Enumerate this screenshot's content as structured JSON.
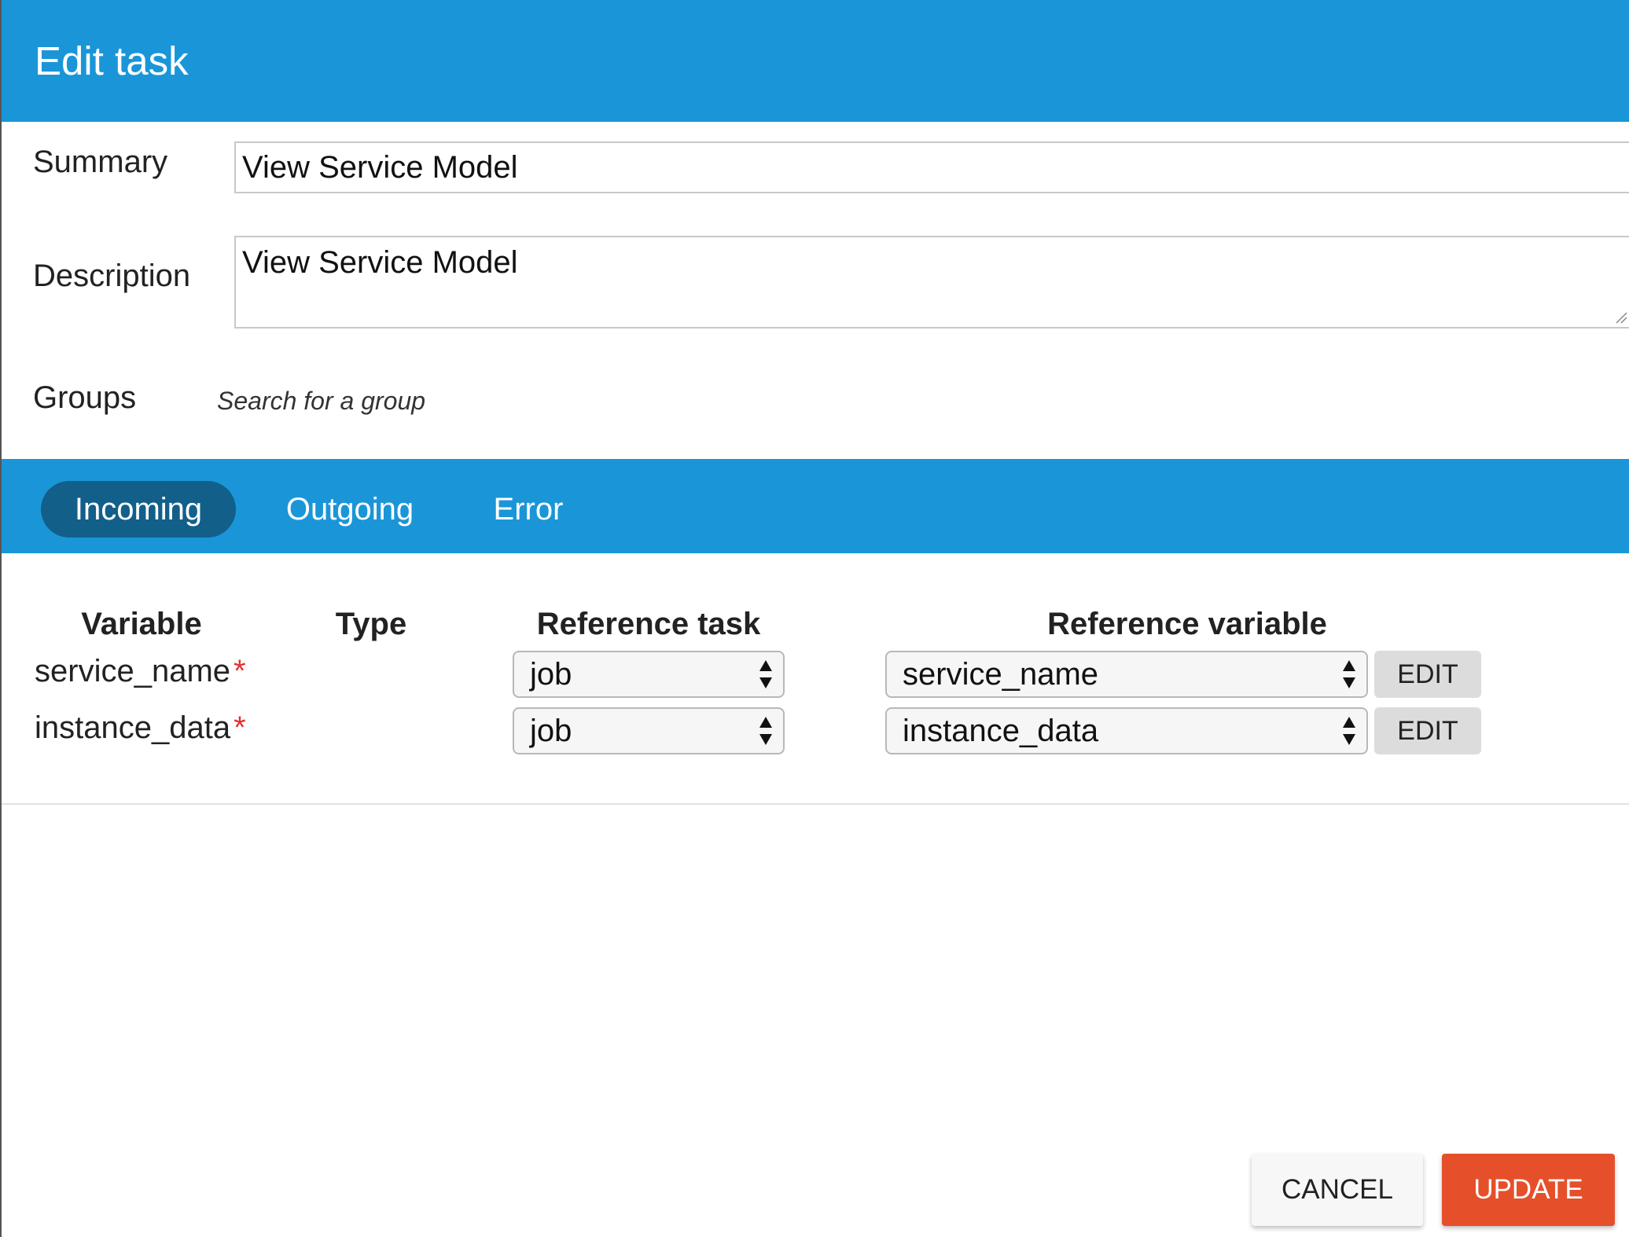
{
  "dialog": {
    "title": "Edit task"
  },
  "form": {
    "summary": {
      "label": "Summary",
      "value": "View Service Model"
    },
    "description": {
      "label": "Description",
      "value": "View Service Model"
    },
    "groups": {
      "label": "Groups",
      "placeholder": "Search for a group"
    }
  },
  "tabs": [
    {
      "label": "Incoming",
      "active": true
    },
    {
      "label": "Outgoing",
      "active": false
    },
    {
      "label": "Error",
      "active": false
    }
  ],
  "table": {
    "headers": {
      "variable": "Variable",
      "type": "Type",
      "reference_task": "Reference task",
      "reference_variable": "Reference variable"
    },
    "required_marker": "*",
    "rows": [
      {
        "variable": "service_name",
        "required": true,
        "type": "",
        "reference_task": "job",
        "reference_variable": "service_name",
        "edit_label": "EDIT"
      },
      {
        "variable": "instance_data",
        "required": true,
        "type": "",
        "reference_task": "job",
        "reference_variable": "instance_data",
        "edit_label": "EDIT"
      }
    ]
  },
  "footer": {
    "cancel_label": "CANCEL",
    "update_label": "UPDATE"
  },
  "colors": {
    "header_blue": "#1a96d8",
    "active_tab": "#125f8a",
    "update_orange": "#e5502a",
    "required_red": "#e53030"
  },
  "icons": {
    "select_arrows": "updown-arrows-icon",
    "resize_handle": "resize-grip-icon"
  }
}
